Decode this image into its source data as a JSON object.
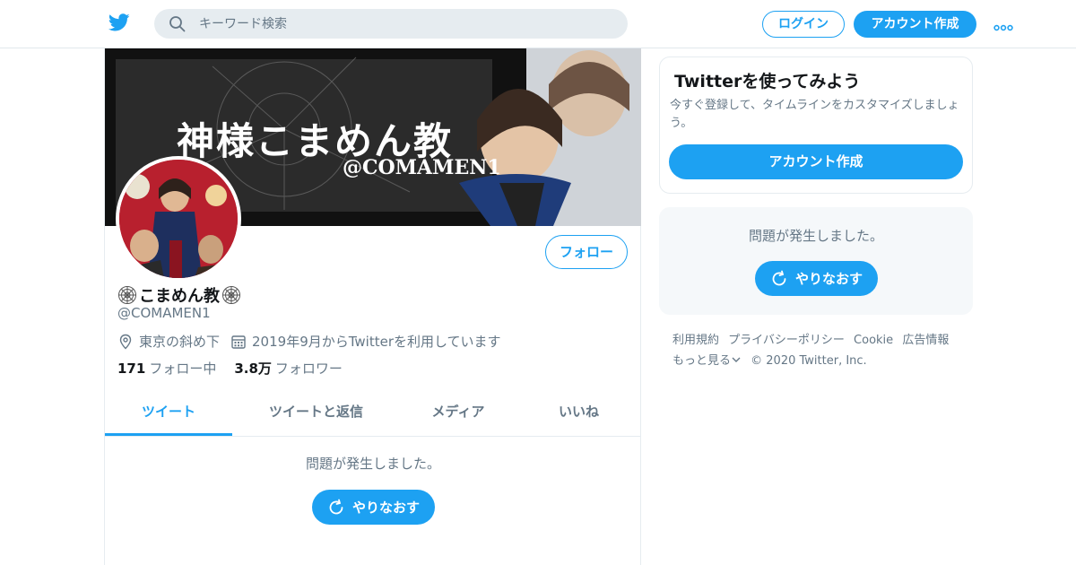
{
  "colors": {
    "accent": "#1da1f2",
    "text_primary": "#14171a",
    "text_secondary": "#657786",
    "border": "#e6ecf0",
    "panel_bg": "#f5f8fa"
  },
  "header": {
    "logo_icon": "twitter-bird-icon",
    "search_placeholder": "キーワード検索",
    "login_label": "ログイン",
    "signup_label": "アカウント作成",
    "more_icon": "more-dots-icon"
  },
  "profile": {
    "banner_title": "神様こまめん教",
    "banner_handle": "@COMAMEN1",
    "display_name": "こまめん教",
    "name_icon": "spider-web-icon",
    "handle": "@COMAMEN1",
    "location": "東京の斜め下",
    "joined": "2019年9月からTwitterを利用しています",
    "following_count": "171",
    "following_label": "フォロー中",
    "followers_count": "3.8万",
    "followers_label": "フォロワー",
    "follow_label": "フォロー"
  },
  "tabs": [
    {
      "label": "ツイート",
      "active": true
    },
    {
      "label": "ツイートと返信",
      "active": false
    },
    {
      "label": "メディア",
      "active": false
    },
    {
      "label": "いいね",
      "active": false
    }
  ],
  "timeline": {
    "error_text": "問題が発生しました。",
    "retry_label": "やりなおす"
  },
  "sidebar": {
    "signup_title": "Twitterを使ってみよう",
    "signup_desc": "今すぐ登録して、タイムラインをカスタマイズしましょう。",
    "signup_button": "アカウント作成",
    "error_text": "問題が発生しました。",
    "retry_label": "やりなおす"
  },
  "footer": {
    "links": [
      "利用規約",
      "プライバシーポリシー",
      "Cookie",
      "広告情報"
    ],
    "more_label": "もっと見る",
    "copyright": "© 2020 Twitter, Inc."
  }
}
